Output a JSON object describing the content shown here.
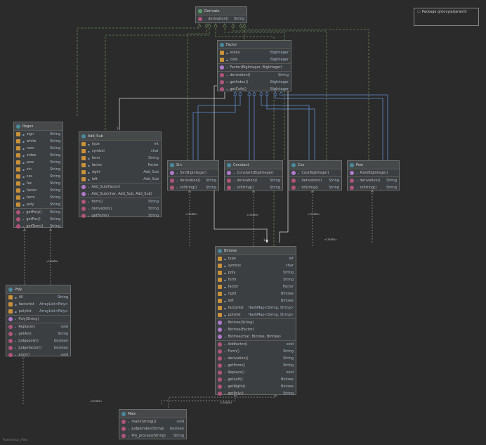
{
  "diagram": {
    "classes": {
      "derivate": {
        "name": "Derivate",
        "kind": "interface",
        "members": [
          {
            "icon": "method",
            "name": "derivation()",
            "type": "String"
          }
        ]
      },
      "factor": {
        "name": "Factor",
        "kind": "abstract",
        "fields": [
          {
            "name": "index",
            "type": "BigInteger"
          },
          {
            "name": "cofe",
            "type": "BigInteger"
          }
        ],
        "constructors": [
          {
            "name": "Factor(BigInteger, BigInteger)",
            "type": ""
          }
        ],
        "methods": [
          {
            "name": "derivation()",
            "type": "String"
          },
          {
            "name": "getIndex()",
            "type": "BigInteger"
          },
          {
            "name": "getCofe()",
            "type": "BigInteger"
          }
        ]
      },
      "regex": {
        "name": "Regex",
        "kind": "class",
        "fields": [
          {
            "name": "sign",
            "type": "String"
          },
          {
            "name": "white",
            "type": "String"
          },
          {
            "name": "num",
            "type": "String"
          },
          {
            "name": "index",
            "type": "String"
          },
          {
            "name": "pow",
            "type": "String"
          },
          {
            "name": "sin",
            "type": "String"
          },
          {
            "name": "cos",
            "type": "String"
          },
          {
            "name": "fac",
            "type": "String"
          },
          {
            "name": "factor",
            "type": "String"
          },
          {
            "name": "term",
            "type": "String"
          },
          {
            "name": "poly",
            "type": "String"
          }
        ],
        "methods": [
          {
            "name": "getPoly()",
            "type": "String"
          },
          {
            "name": "getFac()",
            "type": "String"
          },
          {
            "name": "getTerm()",
            "type": "String"
          }
        ]
      },
      "add_sub": {
        "name": "Add_Sub",
        "kind": "class",
        "fields": [
          {
            "name": "type",
            "type": "int"
          },
          {
            "name": "symbol",
            "type": "char"
          },
          {
            "name": "form",
            "type": "String"
          },
          {
            "name": "factor",
            "type": "Factor"
          },
          {
            "name": "right",
            "type": "Add_Sub"
          },
          {
            "name": "left",
            "type": "Add_Sub"
          }
        ],
        "constructors": [
          {
            "name": "Add_Sub(Factor)",
            "type": ""
          },
          {
            "name": "Add_Sub(char, Add_Sub, Add_Sub)",
            "type": ""
          }
        ],
        "methods": [
          {
            "name": "form()",
            "type": "String"
          },
          {
            "name": "derivation()",
            "type": "String"
          },
          {
            "name": "getForm()",
            "type": "String"
          }
        ]
      },
      "sin": {
        "name": "Sin",
        "kind": "class",
        "constructors": [
          {
            "name": "Sin(BigInteger)",
            "type": ""
          }
        ],
        "methods": [
          {
            "name": "derivation()",
            "type": "String"
          },
          {
            "name": "toString()",
            "type": "String"
          }
        ]
      },
      "constant": {
        "name": "Constant",
        "kind": "class",
        "constructors": [
          {
            "name": "Constant(BigInteger)",
            "type": ""
          }
        ],
        "methods": [
          {
            "name": "derivation()",
            "type": "String"
          },
          {
            "name": "toString()",
            "type": "String"
          }
        ]
      },
      "cos": {
        "name": "Cos",
        "kind": "class",
        "constructors": [
          {
            "name": "Cos(BigInteger)",
            "type": ""
          }
        ],
        "methods": [
          {
            "name": "derivation()",
            "type": "String"
          },
          {
            "name": "toString()",
            "type": "String"
          }
        ]
      },
      "pow": {
        "name": "Pow",
        "kind": "class",
        "constructors": [
          {
            "name": "Pow(BigInteger)",
            "type": ""
          }
        ],
        "methods": [
          {
            "name": "derivation()",
            "type": "String"
          },
          {
            "name": "toString()",
            "type": "String"
          }
        ]
      },
      "poly": {
        "name": "Poly",
        "kind": "class",
        "fields": [
          {
            "name": "All",
            "type": "String"
          },
          {
            "name": "factorlist",
            "type": "ArrayList<Poly>"
          },
          {
            "name": "polylist",
            "type": "ArrayList<Poly>"
          }
        ],
        "constructors": [
          {
            "name": "Poly(String)",
            "type": ""
          }
        ],
        "methods": [
          {
            "name": "Replace()",
            "type": "void"
          },
          {
            "name": "getAll()",
            "type": "String"
          },
          {
            "name": "judgepoly()",
            "type": "boolean"
          },
          {
            "name": "Judgefactor()",
            "type": "boolean"
          },
          {
            "name": "print()",
            "type": "void"
          }
        ]
      },
      "bintree": {
        "name": "Bintree",
        "kind": "class",
        "fields": [
          {
            "name": "type",
            "type": "int"
          },
          {
            "name": "symbol",
            "type": "char"
          },
          {
            "name": "poly",
            "type": "String"
          },
          {
            "name": "form",
            "type": "String"
          },
          {
            "name": "factor",
            "type": "Factor"
          },
          {
            "name": "right",
            "type": "Bintree"
          },
          {
            "name": "left",
            "type": "Bintree"
          },
          {
            "name": "factorlist",
            "type": "HashMap<String, String>"
          },
          {
            "name": "polylist",
            "type": "HashMap<String, String>"
          }
        ],
        "constructors": [
          {
            "name": "Bintree(String)",
            "type": ""
          },
          {
            "name": "Bintree(Factor)",
            "type": ""
          },
          {
            "name": "Bintree(char, Bintree, Bintree)",
            "type": ""
          }
        ],
        "methods": [
          {
            "name": "Addfactor()",
            "type": "void"
          },
          {
            "name": "Form()",
            "type": "String"
          },
          {
            "name": "derivation()",
            "type": "String"
          },
          {
            "name": "getForm()",
            "type": "String"
          },
          {
            "name": "Replace()",
            "type": "void"
          },
          {
            "name": "getLeft()",
            "type": "Bintree"
          },
          {
            "name": "getRight()",
            "type": "Bintree"
          },
          {
            "name": "getPoly()",
            "type": "String"
          }
        ]
      },
      "main": {
        "name": "Main",
        "kind": "class",
        "methods": [
          {
            "name": "main(String[])",
            "type": "void"
          },
          {
            "name": "Judgeindex(String)",
            "type": "boolean"
          },
          {
            "name": "Pre_process(String)",
            "type": "String"
          }
        ]
      }
    },
    "edge_labels": {
      "create": "«create»",
      "one": "1"
    },
    "package_label": "Package groovyjarjarantlr",
    "footer": "Powered by yFiles",
    "colors": {
      "background": "#2b2b2b",
      "box": "#3c3f41",
      "realization": "#6a8759",
      "inheritance": "#5f8fd0",
      "dependency": "#9a9a9a",
      "association": "#cfcfcf"
    },
    "icon_legend": {
      "class": "class-icon",
      "interface": "interface-icon",
      "field": "field-icon",
      "method": "method-icon",
      "constructor": "constructor-icon"
    }
  }
}
